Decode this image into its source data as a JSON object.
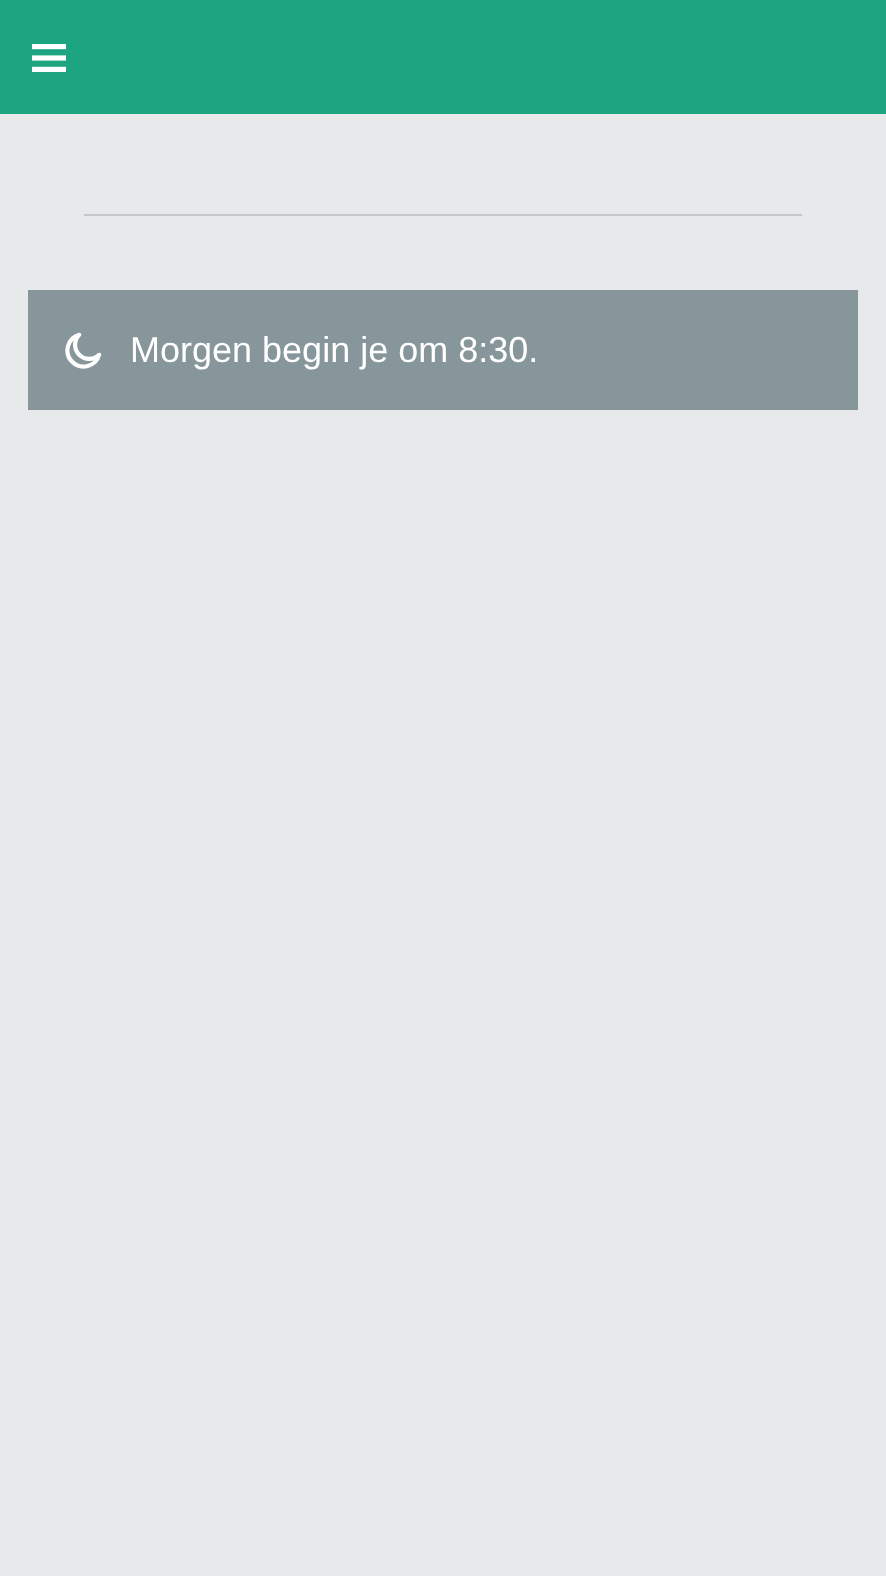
{
  "notice": {
    "kind": "night",
    "text": "Morgen begin je om 8:30."
  }
}
